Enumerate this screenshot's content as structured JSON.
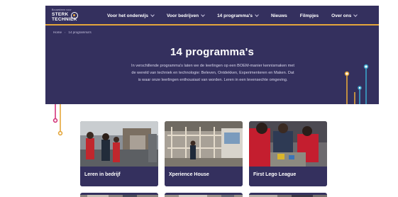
{
  "header": {
    "logo": {
      "tagline": "Bouwsteen voor",
      "line1": "STERK",
      "line2": "TECHNIEK"
    },
    "menu": [
      {
        "label": "Voor het onderwijs",
        "has_dropdown": true
      },
      {
        "label": "Voor bedrijven",
        "has_dropdown": true
      },
      {
        "label": "14 programma's",
        "has_dropdown": true
      },
      {
        "label": "Nieuws",
        "has_dropdown": false
      },
      {
        "label": "Filmpjes",
        "has_dropdown": false
      },
      {
        "label": "Over ons",
        "has_dropdown": true
      }
    ]
  },
  "breadcrumb": {
    "home": "Home",
    "separator": "›",
    "current": "14 programma's"
  },
  "hero": {
    "title": "14 programma's",
    "intro": "In verschillende programma's laten we de leerlingen op een BOEM-manier kennismaken met de wereld van techniek en technologie: Beleven, Ontdekken, Experimenteren en Maken. Dat is waar onze leerlingen enthousiast van worden. Leren in een levensechte omgeving."
  },
  "cards": [
    {
      "label": "Leren in bedrijf"
    },
    {
      "label": "Xperience House"
    },
    {
      "label": "First Lego League"
    }
  ],
  "colors": {
    "brand_dark": "#34305e",
    "accent_gold": "#e4a63b",
    "accent_pink": "#d3357a",
    "accent_teal": "#3aa3c9"
  }
}
